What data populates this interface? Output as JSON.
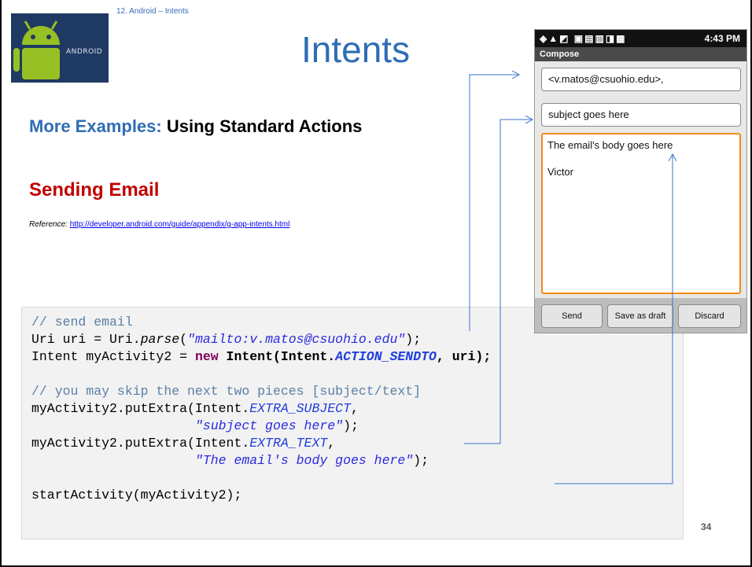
{
  "slide": {
    "section_label": "12. Android – Intents",
    "title": "Intents",
    "heading_accent": "More Examples:",
    "heading_rest": " Using Standard Actions",
    "subheading": "Sending Email",
    "reference_label": "Reference:",
    "reference_url": "http://developer.android.com/guide/appendix/g-app-intents.html",
    "page_number": "34",
    "logo_text": "ANDROID"
  },
  "code": {
    "l1_comment": "// send email",
    "l2_a": "Uri uri = Uri.",
    "l2_b": "parse",
    "l2_c": "(",
    "l2_d": "\"mailto:v.matos@csuohio.edu\"",
    "l2_e": ");",
    "l3_a": "Intent myActivity2 = ",
    "l3_b": "new",
    "l3_c": " Intent(Intent.",
    "l3_d": "ACTION_SENDTO",
    "l3_e": ", uri);",
    "l5_comment": "// you may skip the next two pieces [subject/text]",
    "l6_a": "myActivity2.putExtra(Intent.",
    "l6_b": "EXTRA_SUBJECT",
    "l6_c": ",",
    "l7_indent": "                     ",
    "l7_a": "\"subject goes here\"",
    "l7_b": ");",
    "l8_a": "myActivity2.putExtra(Intent.",
    "l8_b": "EXTRA_TEXT",
    "l8_c": ",",
    "l9_indent": "                     ",
    "l9_a": "\"The email's body goes here\"",
    "l9_b": ");",
    "l11": "startActivity(myActivity2);"
  },
  "phone": {
    "status_icons": "◈▲◩  ▣▤▥◨▦",
    "status_time": "4:43 PM",
    "compose_label": "Compose",
    "to_field": "<v.matos@csuohio.edu>,",
    "subject_field": "subject goes here",
    "body_line1": "The email's body goes here",
    "body_line2": "Victor",
    "send_button": "Send",
    "save_draft_button": "Save as draft",
    "discard_button": "Discard"
  },
  "colors": {
    "title_blue": "#2e6db5",
    "subheading_red": "#c00000",
    "arrow_blue": "#3b74c9",
    "body_border_orange": "#f08c1a"
  }
}
